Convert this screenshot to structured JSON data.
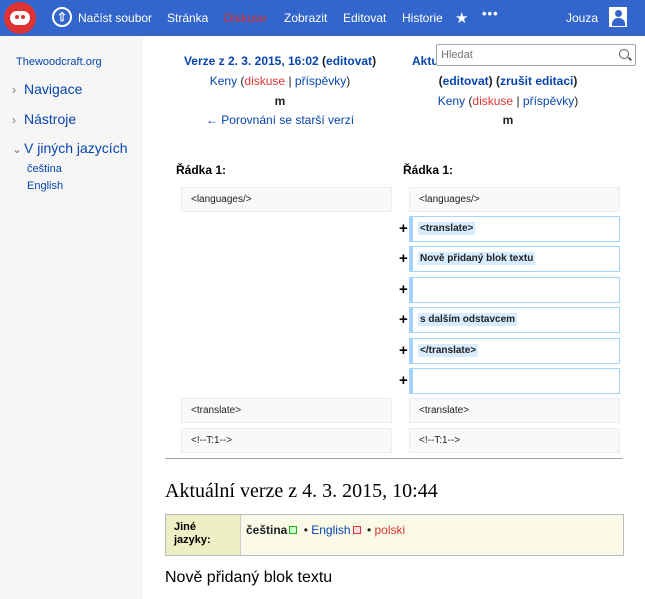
{
  "topbar": {
    "nav": {
      "upload": "Načíst soubor",
      "page": "Stránka",
      "discussion": "Diskuse",
      "view": "Zobrazit",
      "edit": "Editovat",
      "history": "Historie",
      "more": "•••"
    },
    "user": "Jouza",
    "icons": [
      "wiki-logo",
      "upload-icon",
      "star-icon",
      "more-icon",
      "user-avatar-icon"
    ],
    "colors": {
      "bar": "#3366cc",
      "active_tab": "#dd3333"
    }
  },
  "sidebar": {
    "site": "Thewoodcraft.org",
    "sections": {
      "navigation": "Navigace",
      "tools": "Nástroje",
      "languages": "V jiných jazycích"
    },
    "languages": [
      "čeština",
      "English"
    ]
  },
  "search": {
    "placeholder": "Hledat"
  },
  "diff": {
    "left_header": {
      "title": "Verze z 2. 3. 2015, 16:02",
      "edit": "editovat",
      "user": "Keny",
      "talk": "diskuse",
      "contribs": "příspěvky",
      "minor": "m",
      "older": "← Porovnání se starší verzí"
    },
    "right_header": {
      "title_partial": "Aktu",
      "edit": "editovat",
      "undo": "zrušit editaci",
      "user": "Keny",
      "talk": "diskuse",
      "contribs": "příspěvky",
      "minor": "m"
    },
    "line_label": "Řádka 1:",
    "rows": {
      "languages": "<languages/>",
      "added": [
        "<translate>",
        "Nově přidaný blok textu",
        "",
        "s dalším odstavcem",
        "</translate>",
        ""
      ],
      "translate": "<translate>",
      "comment": "<!--T:1-->"
    },
    "colors": {
      "added_border": "#a3d3ff",
      "added_highlight": "#d8ecff",
      "context_bg": "#f8f9fa"
    }
  },
  "content": {
    "heading": "Aktuální verze z 4. 3. 2015, 10:44",
    "lang_box": {
      "label_line1": "Jiné",
      "label_line2": "jazyky:",
      "langs": [
        "čeština",
        "English",
        "polski"
      ],
      "separator": "•"
    },
    "paragraph": "Nově přidaný blok textu"
  }
}
